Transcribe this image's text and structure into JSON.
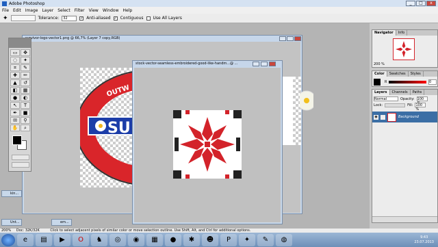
{
  "app": {
    "title": "Adobe Photoshop"
  },
  "menu": [
    "File",
    "Edit",
    "Image",
    "Layer",
    "Select",
    "Filter",
    "View",
    "Window",
    "Help"
  ],
  "options": {
    "tolerance_label": "Tolerance:",
    "tolerance_value": "32",
    "anti_aliased": "Anti-aliased",
    "contiguous": "Contiguous",
    "use_all_layers": "Use All Layers"
  },
  "documents": [
    {
      "title": "survivor-logo-vector1.png @ 66,7% (Layer 7 copy,RGB)"
    },
    {
      "title": "stock-vector-seamless-embroidered-good-like-handm...@ ..."
    }
  ],
  "logo_text": {
    "top": "OUTW",
    "main": "SU"
  },
  "minimized": [
    "kin...",
    "Unt...",
    "em..."
  ],
  "navigator": {
    "tabs": [
      "Navigator",
      "Info"
    ],
    "zoom": "200 %"
  },
  "color_panel": {
    "tabs": [
      "Color",
      "Swatches",
      "Styles"
    ],
    "r_label": "R",
    "r_value": "0"
  },
  "layers": {
    "tabs": [
      "Layers",
      "Channels",
      "Paths"
    ],
    "blend": "Normal",
    "opacity_label": "Opacity:",
    "opacity": "100 %",
    "lock_label": "Lock:",
    "fill_label": "Fill:",
    "fill": "100 %",
    "layer_name": "Background"
  },
  "status": {
    "zoom": "200%",
    "doc": "Doc: 32K/32K",
    "hint": "Click to select adjacent pixels of similar color or move selection outline. Use Shift, Alt, and Ctrl for additional options."
  },
  "clock": {
    "time": "9:43",
    "date": "23.07.2013"
  },
  "taskbar_icons": [
    "ie-icon",
    "folder-icon",
    "media-icon",
    "opera-icon",
    "game-icon",
    "chrome-icon",
    "firefox-icon",
    "calc-icon",
    "orb-icon",
    "ps-icon",
    "gimp-icon",
    "photoshop-icon",
    "ps2-icon",
    "paint-icon",
    "burn-icon"
  ]
}
